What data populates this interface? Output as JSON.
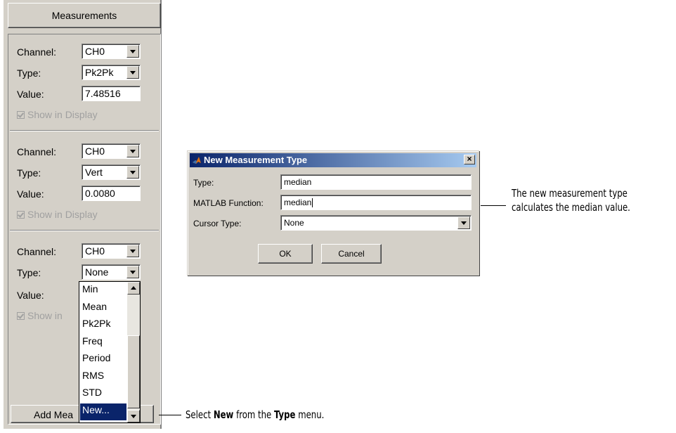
{
  "panel": {
    "title": "Measurements",
    "groups": [
      {
        "channel_label": "Channel:",
        "channel": "CH0",
        "type_label": "Type:",
        "type": "Pk2Pk",
        "value_label": "Value:",
        "value": "7.48516",
        "show_label": "Show in Display"
      },
      {
        "channel_label": "Channel:",
        "channel": "CH0",
        "type_label": "Type:",
        "type": "Vert",
        "value_label": "Value:",
        "value": "0.0080",
        "show_label": "Show in Display"
      },
      {
        "channel_label": "Channel:",
        "channel": "CH0",
        "type_label": "Type:",
        "type": "None",
        "value_label": "Value:",
        "show_label": "Show in"
      }
    ],
    "add_button": "Add Mea"
  },
  "dropdown": {
    "items": [
      "Min",
      "Mean",
      "Pk2Pk",
      "Freq",
      "Period",
      "RMS",
      "STD",
      "New..."
    ],
    "selected": "New..."
  },
  "dialog": {
    "title": "New Measurement Type",
    "type_label": "Type:",
    "type_value": "median",
    "function_label": "MATLAB Function:",
    "function_value": "median",
    "cursor_label": "Cursor Type:",
    "cursor_value": "None",
    "ok_label": "OK",
    "cancel_label": "Cancel"
  },
  "callouts": {
    "dialog_line1": "The new measurement type",
    "dialog_line2": "calculates the median value.",
    "menu_pre": "Select ",
    "menu_b1": "New",
    "menu_mid": " from the ",
    "menu_b2": "Type",
    "menu_post": " menu."
  },
  "colors": {
    "face": "#d4d0c8",
    "selection": "#0a246a",
    "title_start": "#0a246a",
    "title_end": "#a6caf0"
  }
}
